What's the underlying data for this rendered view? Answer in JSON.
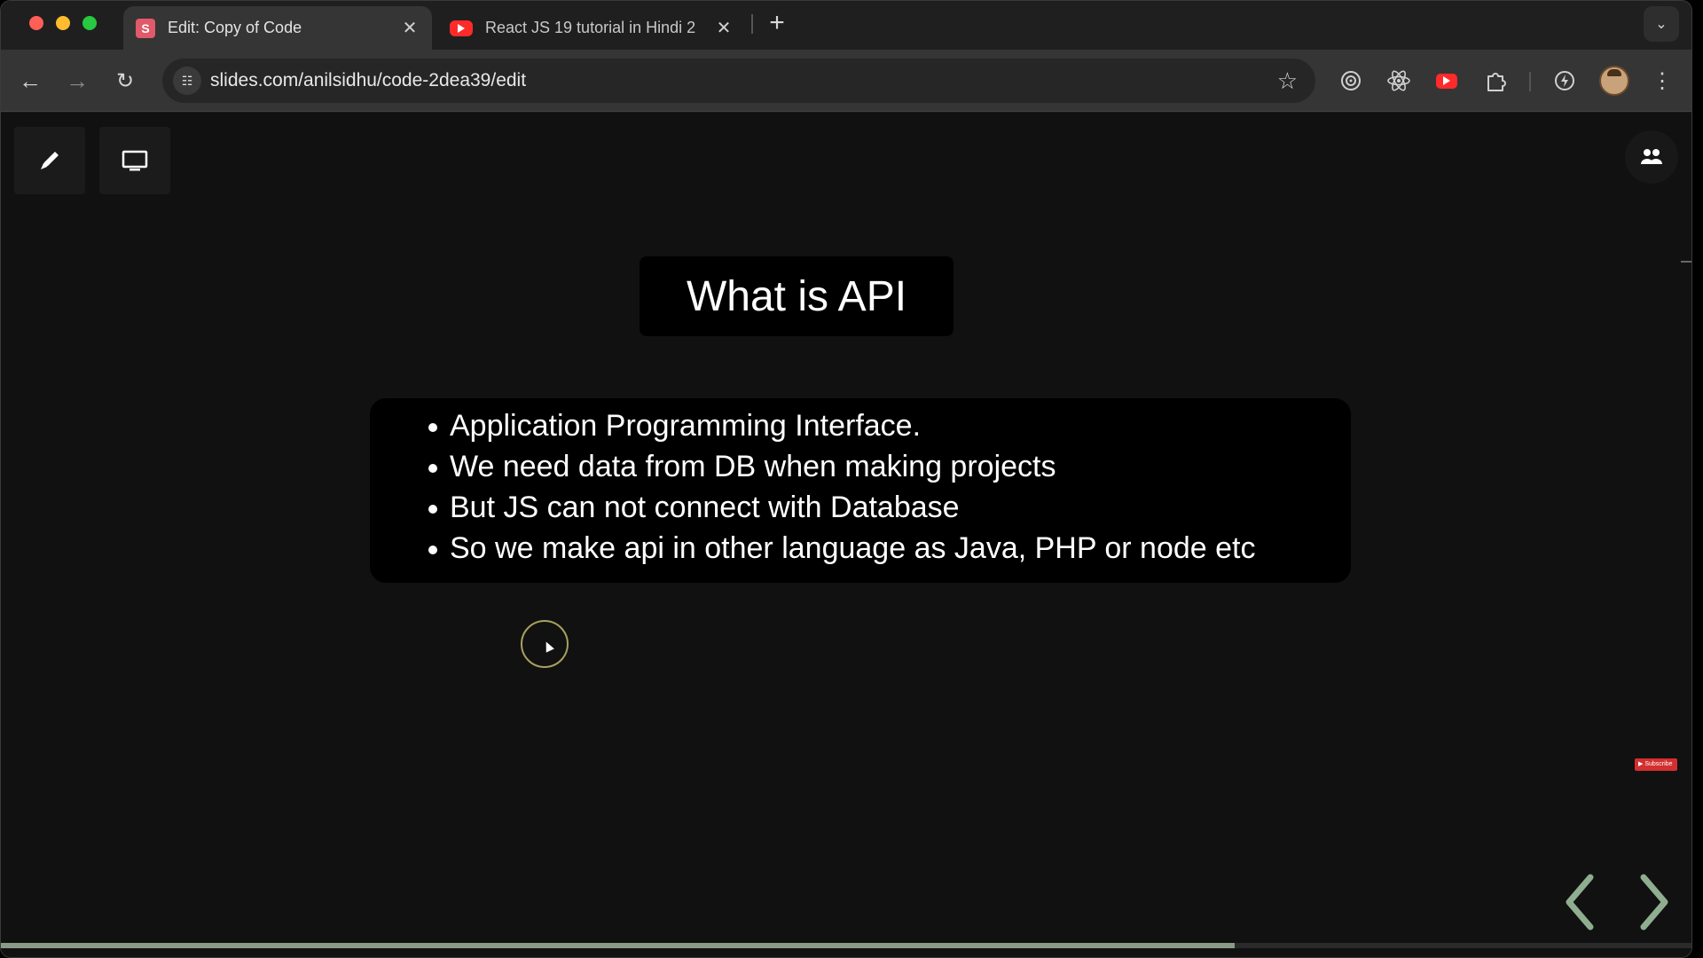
{
  "browser": {
    "tabs": [
      {
        "title": "Edit: Copy of Code",
        "favicon_letter": "S",
        "active": true
      },
      {
        "title": "React JS 19 tutorial in Hindi 2",
        "active": false
      }
    ],
    "new_tab_label": "+",
    "url": "slides.com/anilsidhu/code-2dea39/edit",
    "extension_icons": [
      "target-icon",
      "react-icon",
      "youtube-icon",
      "puzzle-icon",
      "speed-icon"
    ]
  },
  "slide": {
    "title": "What is API",
    "bullets": [
      "Application Programming Interface.",
      "We need data from DB when making projects",
      "But JS can not connect with Database",
      "So we make api in other language as Java, PHP or node etc"
    ],
    "progress": 0.73
  },
  "colors": {
    "slide_background": "#111111",
    "text_box": "#000000",
    "nav_arrow": "#8fae8f",
    "progress_fill": "#8a9a88"
  }
}
